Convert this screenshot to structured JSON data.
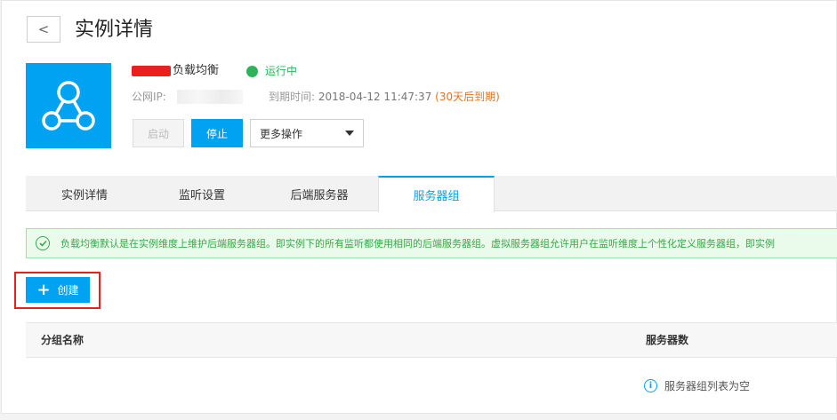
{
  "header": {
    "back_icon": "chevron-left-icon",
    "back_glyph": "<",
    "title": "实例详情"
  },
  "instance": {
    "logo_icon": "load-balancer-icon",
    "name_suffix": "负载均衡",
    "status": "运行中",
    "status_color": "#2db45b",
    "public_ip_label": "公网IP:",
    "expire_label": "到期时间:",
    "expire_value": "2018-04-12 11:47:37",
    "expire_note": "(30天后到期)"
  },
  "actions": {
    "start_label": "启动",
    "stop_label": "停止",
    "more_label": "更多操作"
  },
  "tabs": [
    {
      "label": "实例详情"
    },
    {
      "label": "监听设置"
    },
    {
      "label": "后端服务器"
    },
    {
      "label": "服务器组"
    }
  ],
  "active_tab": 3,
  "notice": {
    "icon": "check-circle-icon",
    "text": "负载均衡默认是在实例维度上维护后端服务器组。即实例下的所有监听都使用相同的后端服务器组。虚拟服务器组允许用户在监听维度上个性化定义服务器组，即实例"
  },
  "create_button": {
    "icon": "plus-icon",
    "glyph": "+",
    "label": "创建"
  },
  "table": {
    "columns": [
      "分组名称",
      "服务器数"
    ],
    "empty_text": "服务器组列表为空",
    "empty_icon": "info-icon"
  },
  "colors": {
    "primary": "#00a2f1",
    "success": "#2db45b",
    "warning": "#e8731a",
    "highlight": "#e8211f"
  }
}
